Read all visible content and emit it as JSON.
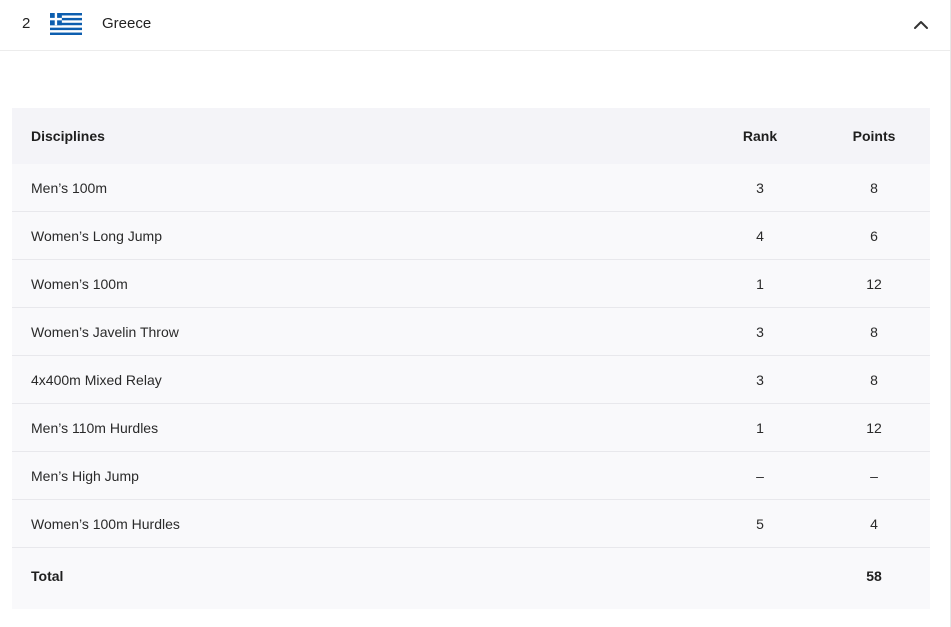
{
  "header": {
    "position": "2",
    "country": "Greece",
    "flag_icon": "greece-flag-icon",
    "toggle_icon": "chevron-up-icon",
    "colors": {
      "flag_blue": "#0d5eaf",
      "flag_white": "#ffffff"
    }
  },
  "table": {
    "columns": [
      "Disciplines",
      "Rank",
      "Points"
    ],
    "rows": [
      {
        "discipline": "Men’s 100m",
        "rank": "3",
        "points": "8"
      },
      {
        "discipline": "Women’s Long Jump",
        "rank": "4",
        "points": "6"
      },
      {
        "discipline": "Women’s 100m",
        "rank": "1",
        "points": "12"
      },
      {
        "discipline": "Women’s Javelin Throw",
        "rank": "3",
        "points": "8"
      },
      {
        "discipline": "4x400m Mixed Relay",
        "rank": "3",
        "points": "8"
      },
      {
        "discipline": "Men’s 110m Hurdles",
        "rank": "1",
        "points": "12"
      },
      {
        "discipline": "Men’s High Jump",
        "rank": "–",
        "points": "–"
      },
      {
        "discipline": "Women’s 100m Hurdles",
        "rank": "5",
        "points": "4"
      }
    ],
    "total": {
      "label": "Total",
      "rank": "",
      "points": "58"
    }
  }
}
